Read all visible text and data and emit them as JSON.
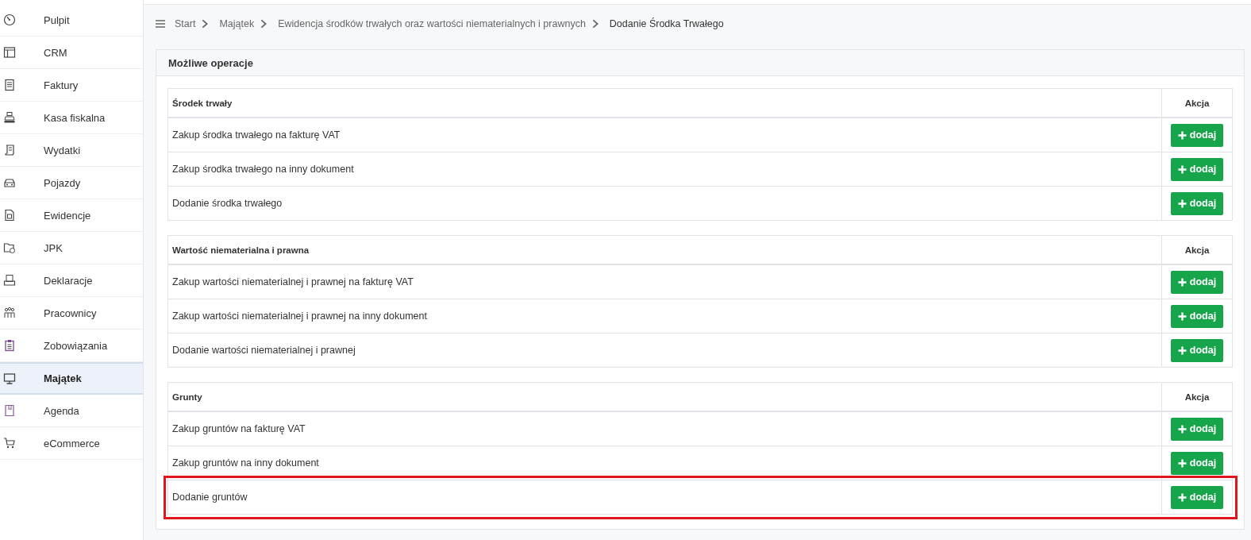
{
  "sidebar": {
    "items": [
      {
        "label": "Pulpit",
        "selected": false
      },
      {
        "label": "CRM",
        "selected": false
      },
      {
        "label": "Faktury",
        "selected": false
      },
      {
        "label": "Kasa fiskalna",
        "selected": false
      },
      {
        "label": "Wydatki",
        "selected": false
      },
      {
        "label": "Pojazdy",
        "selected": false
      },
      {
        "label": "Ewidencje",
        "selected": false
      },
      {
        "label": "JPK",
        "selected": false
      },
      {
        "label": "Deklaracje",
        "selected": false
      },
      {
        "label": "Pracownicy",
        "selected": false
      },
      {
        "label": "Zobowiązania",
        "selected": false
      },
      {
        "label": "Majątek",
        "selected": true
      },
      {
        "label": "Agenda",
        "selected": false
      },
      {
        "label": "eCommerce",
        "selected": false
      }
    ]
  },
  "breadcrumb": [
    "Start",
    "Majątek",
    "Ewidencja środków trwałych oraz wartości niematerialnych i prawnych",
    "Dodanie Środka Trwałego"
  ],
  "panel": {
    "title": "Możliwe operacje",
    "tables": [
      {
        "heading": "Środek trwały",
        "action_heading": "Akcja",
        "rows": [
          {
            "label": "Zakup środka trwałego na fakturę VAT",
            "button": "dodaj",
            "highlighted": false
          },
          {
            "label": "Zakup środka trwałego na inny dokument",
            "button": "dodaj",
            "highlighted": false
          },
          {
            "label": "Dodanie środka trwałego",
            "button": "dodaj",
            "highlighted": false
          }
        ]
      },
      {
        "heading": "Wartość niematerialna i prawna",
        "action_heading": "Akcja",
        "rows": [
          {
            "label": "Zakup wartości niematerialnej i prawnej na fakturę VAT",
            "button": "dodaj",
            "highlighted": false
          },
          {
            "label": "Zakup wartości niematerialnej i prawnej na inny dokument",
            "button": "dodaj",
            "highlighted": false
          },
          {
            "label": "Dodanie wartości niematerialnej i prawnej",
            "button": "dodaj",
            "highlighted": false
          }
        ]
      },
      {
        "heading": "Grunty",
        "action_heading": "Akcja",
        "rows": [
          {
            "label": "Zakup gruntów na fakturę VAT",
            "button": "dodaj",
            "highlighted": false
          },
          {
            "label": "Zakup gruntów na inny dokument",
            "button": "dodaj",
            "highlighted": false
          },
          {
            "label": "Dodanie gruntów",
            "button": "dodaj",
            "highlighted": true
          }
        ]
      }
    ]
  }
}
